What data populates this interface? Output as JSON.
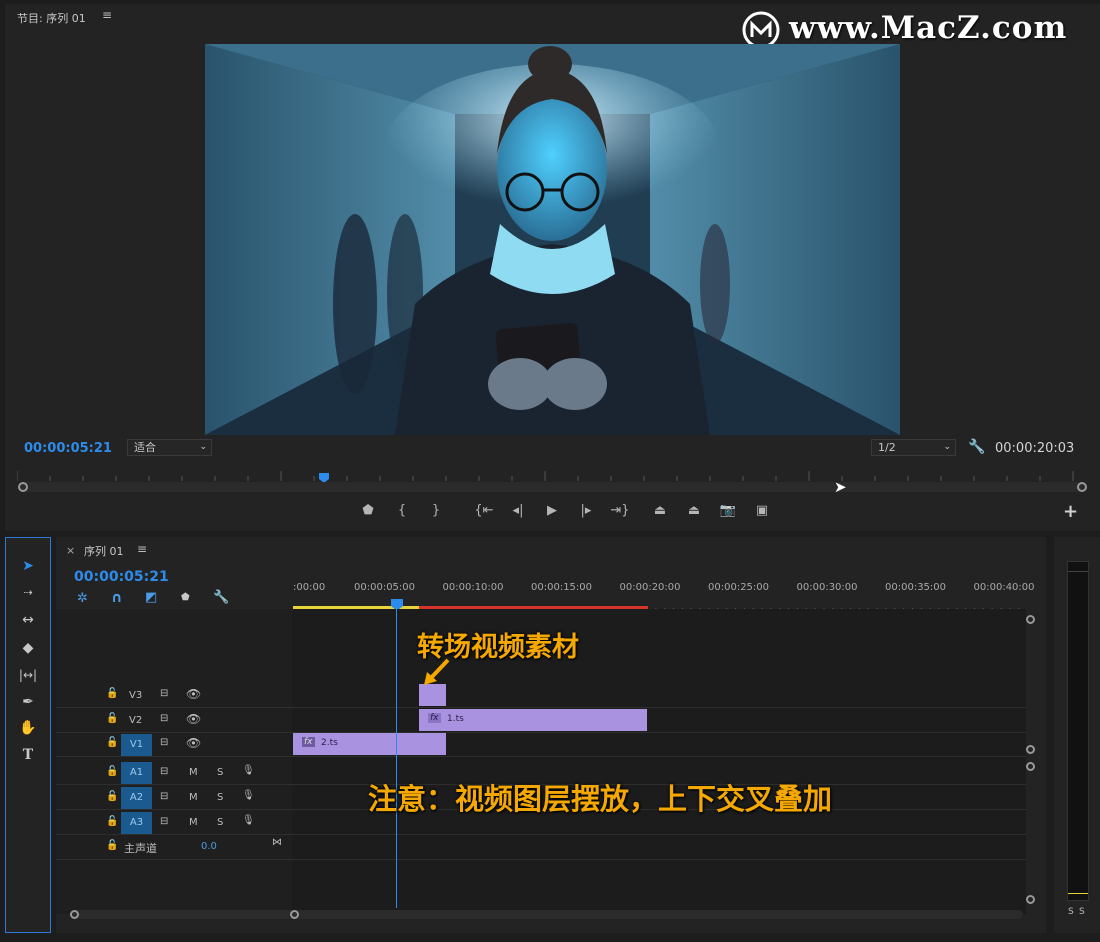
{
  "monitor": {
    "title": "节目: 序列 01",
    "menu_icon": "hamburger-icon",
    "timecode_current": "00:00:05:21",
    "fit_value": "适合",
    "resolution_value": "1/2",
    "timecode_duration": "00:00:20:03",
    "playhead_position_fraction": 0.288
  },
  "watermark": {
    "text": "www.MacZ.com"
  },
  "controls": [
    {
      "name": "add-marker-button",
      "glyph": "⬟"
    },
    {
      "name": "mark-in-button",
      "glyph": "{"
    },
    {
      "name": "mark-out-button",
      "glyph": "}"
    },
    {
      "name": "go-to-in-button",
      "glyph": "{⇤"
    },
    {
      "name": "step-back-button",
      "glyph": "◂|"
    },
    {
      "name": "play-button",
      "glyph": "▶"
    },
    {
      "name": "step-forward-button",
      "glyph": "|▸"
    },
    {
      "name": "go-to-out-button",
      "glyph": "⇥}"
    },
    {
      "name": "lift-button",
      "glyph": "⏏"
    },
    {
      "name": "extract-button",
      "glyph": "⏏"
    },
    {
      "name": "export-frame-button",
      "glyph": "📷"
    },
    {
      "name": "comparison-view-button",
      "glyph": "▣"
    }
  ],
  "add_button": "+",
  "timeline": {
    "tab_close": "×",
    "tab_title": "序列 01",
    "menu_icon": "hamburger-icon",
    "timecode": "00:00:05:21",
    "ruler_labels": [
      ":00:00",
      "00:00:05:00",
      "00:00:10:00",
      "00:00:15:00",
      "00:00:20:00",
      "00:00:25:00",
      "00:00:30:00",
      "00:00:35:00",
      "00:00:40:00"
    ],
    "video_tracks": [
      {
        "label": "V3",
        "selected": false
      },
      {
        "label": "V2",
        "selected": false
      },
      {
        "label": "V1",
        "selected": true
      }
    ],
    "audio_tracks": [
      {
        "label": "A1",
        "m": "M",
        "s": "S"
      },
      {
        "label": "A2",
        "m": "M",
        "s": "S"
      },
      {
        "label": "A3",
        "m": "M",
        "s": "S"
      }
    ],
    "master": {
      "label": "主声道",
      "value": "0.0"
    },
    "clips": [
      {
        "name": "1.ts",
        "track": "V2"
      },
      {
        "name": "2.ts",
        "track": "V1"
      }
    ],
    "fx_label": "fx"
  },
  "annotations": {
    "top": "转场视频素材",
    "bottom": "注意：视频图层摆放，上下交叉叠加"
  },
  "meters": {
    "solo_left": "S",
    "solo_right": "S"
  },
  "colors": {
    "accent_blue": "#2d8ceb",
    "clip_purple": "#a992e0",
    "annotation_orange": "#f5a800",
    "work_area_yellow": "#e8d43a",
    "render_red": "#d6332d"
  }
}
